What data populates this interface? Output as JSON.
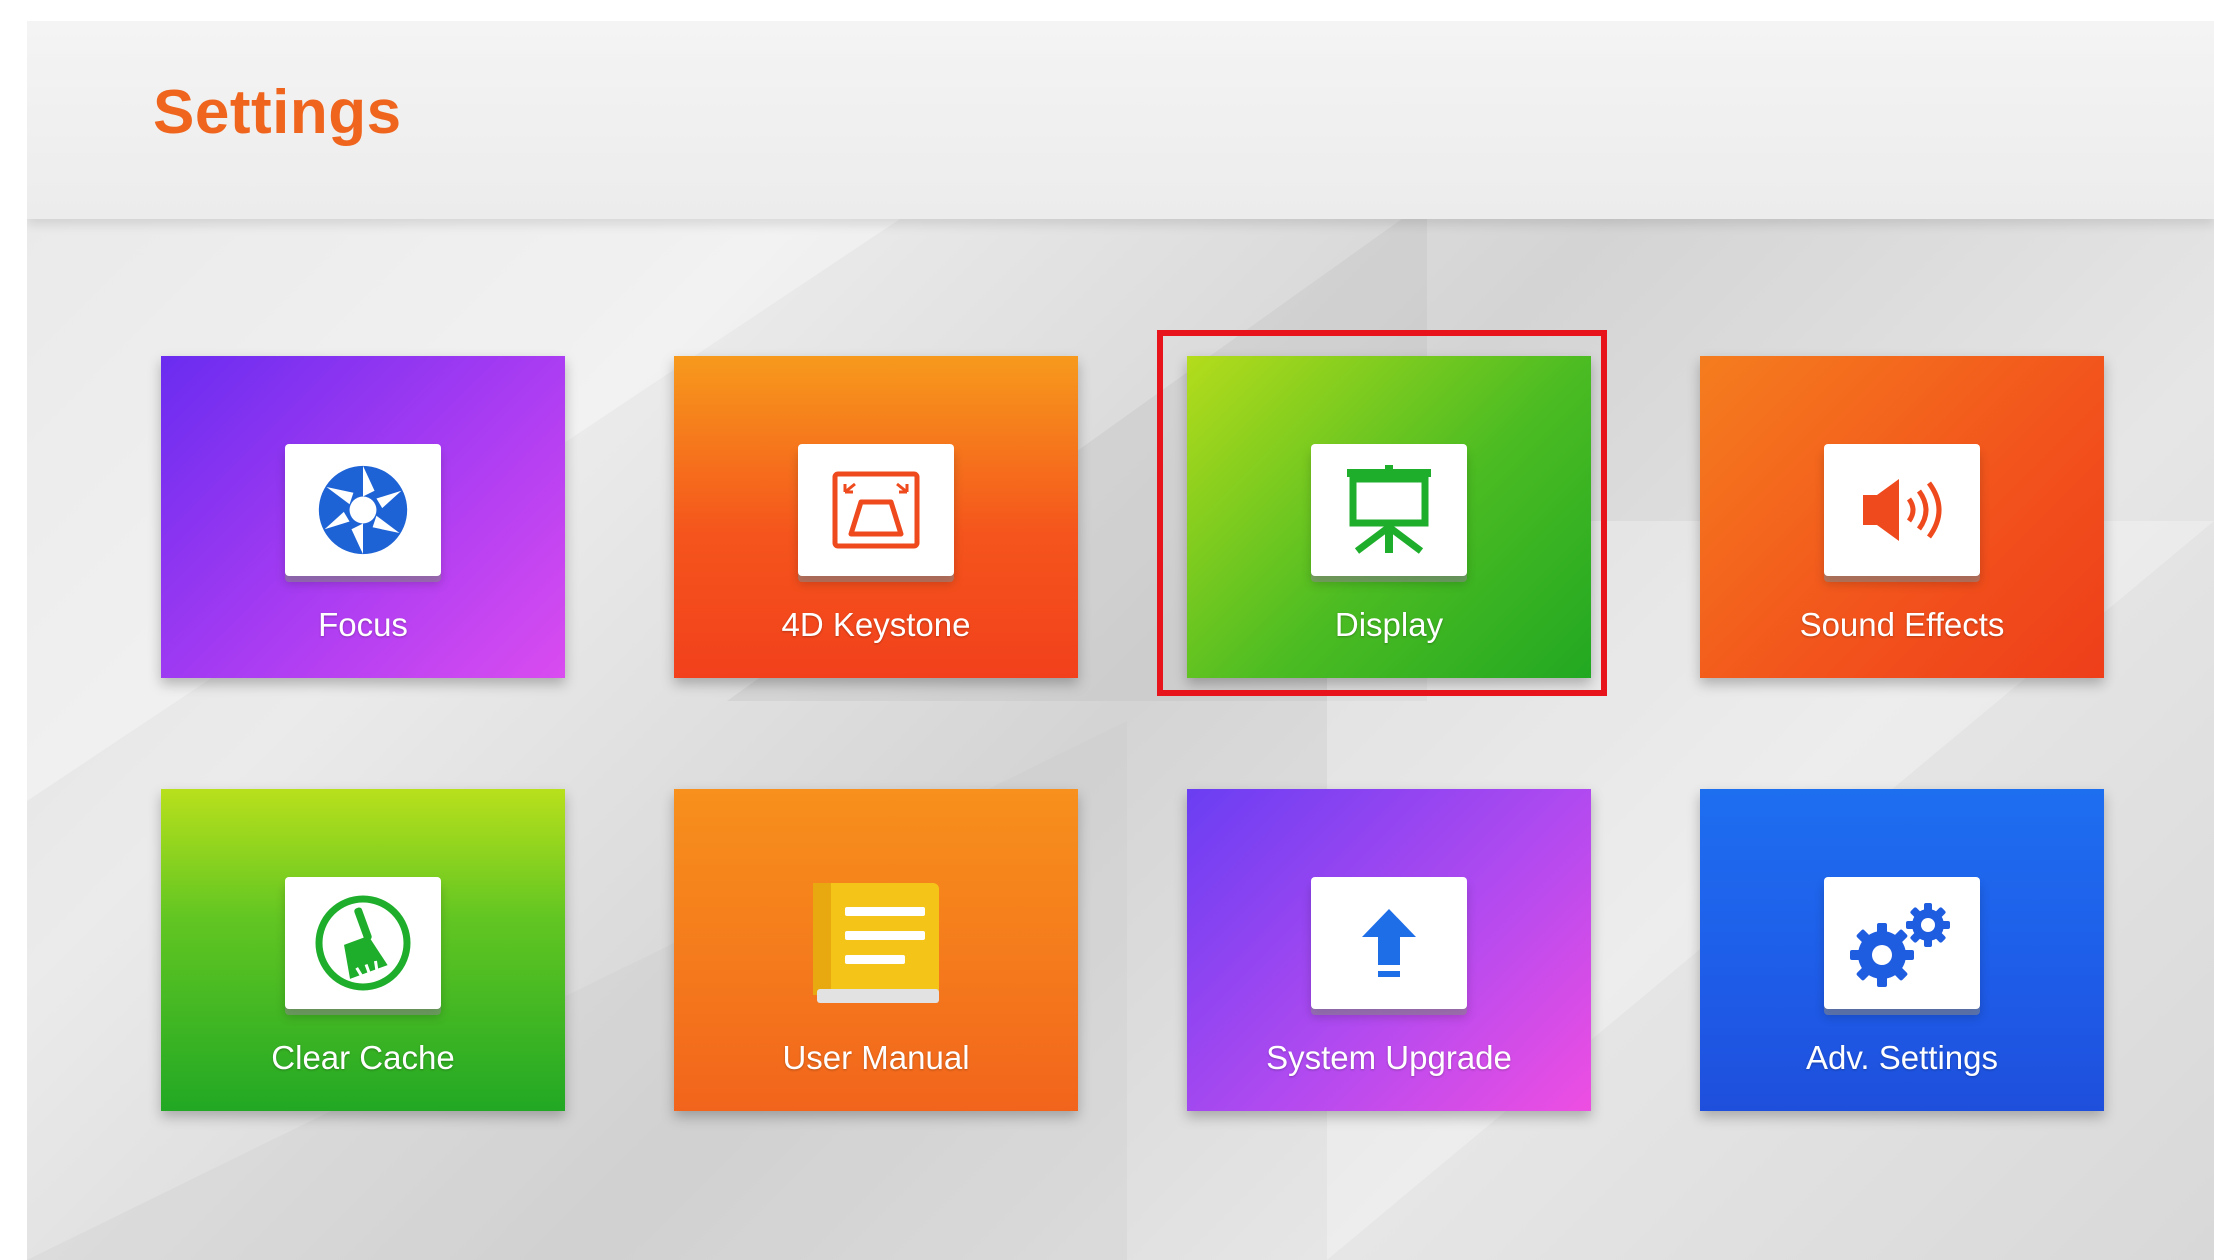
{
  "header": {
    "title": "Settings"
  },
  "tiles": [
    {
      "label": "Focus",
      "icon": "aperture-icon"
    },
    {
      "label": "4D Keystone",
      "icon": "keystone-icon"
    },
    {
      "label": "Display",
      "icon": "projector-screen-icon",
      "selected": true
    },
    {
      "label": "Sound Effects",
      "icon": "speaker-icon"
    },
    {
      "label": "Clear Cache",
      "icon": "broom-icon"
    },
    {
      "label": "User Manual",
      "icon": "book-icon"
    },
    {
      "label": "System Upgrade",
      "icon": "upload-arrow-icon"
    },
    {
      "label": "Adv. Settings",
      "icon": "gears-icon"
    }
  ],
  "colors": {
    "title": "#f0651e",
    "selection_border": "#e8141c"
  }
}
